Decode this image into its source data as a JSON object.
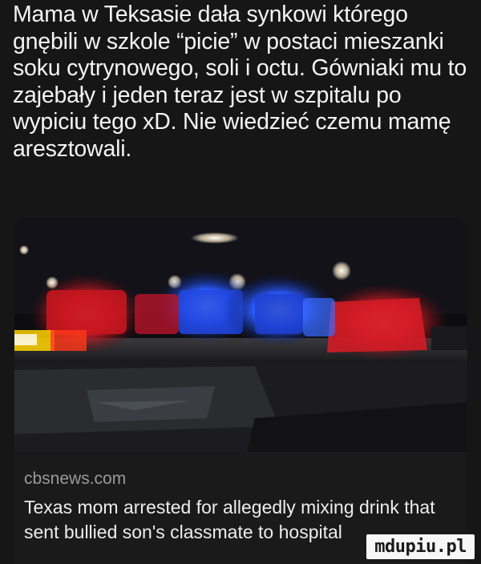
{
  "post": {
    "text": "Mama w Teksasie dała synkowi którego gnębili w szkole “picie” w postaci mieszanki soku cytrynowego, soli i octu. Gówniaki mu to zajebały i jeden teraz jest w szpitalu po wypiciu tego xD. Nie wiedzieć czemu mamę aresztowali."
  },
  "link_card": {
    "source": "cbsnews.com",
    "headline": "Texas mom arrested for allegedly mixing drink that sent bullied son's classmate to hospital"
  },
  "watermark": {
    "text": "mdupiu.pl"
  },
  "colors": {
    "background": "#161616",
    "police_red": "#e0202a",
    "police_blue": "#2a5cff"
  }
}
